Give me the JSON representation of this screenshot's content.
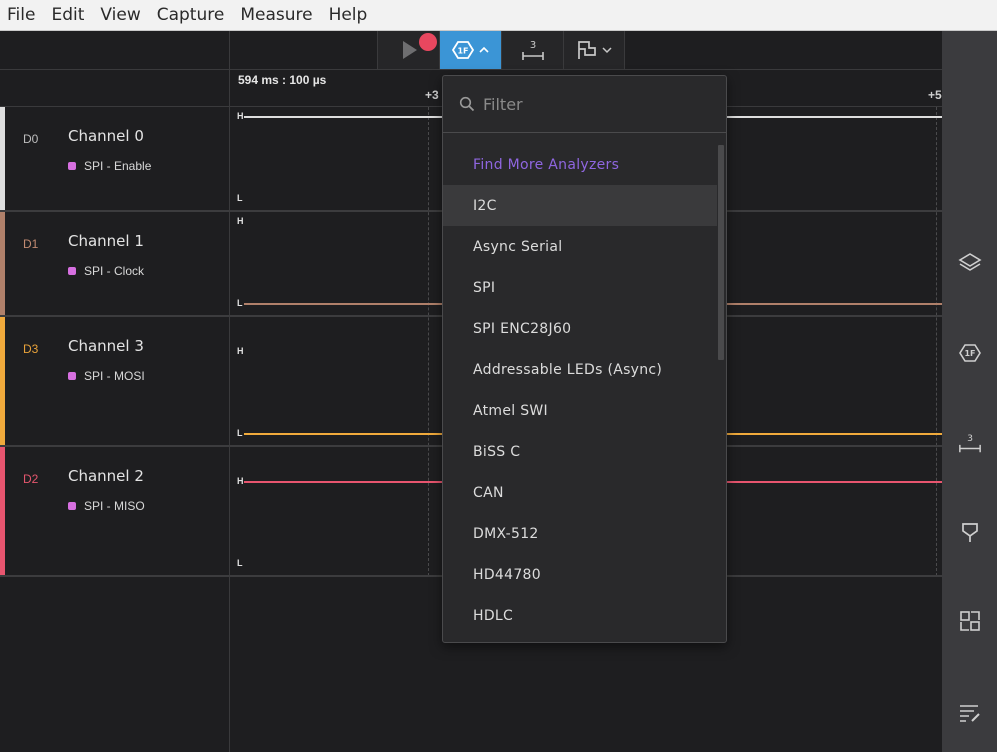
{
  "menubar": [
    "File",
    "Edit",
    "View",
    "Capture",
    "Measure",
    "Help"
  ],
  "timeline": {
    "cursor_time": "594 ms : 100 µs",
    "ticks": [
      "+3",
      "+5"
    ]
  },
  "channels": [
    {
      "id": "D0",
      "name": "Channel 0",
      "analyzer": "SPI - Enable",
      "color": "#dedede",
      "id_color": "#bdbdbd",
      "level_high": "H",
      "level_low": "L",
      "signal": "high"
    },
    {
      "id": "D1",
      "name": "Channel 1",
      "analyzer": "SPI - Clock",
      "color": "#b0806a",
      "id_color": "#c28b72",
      "level_high": "H",
      "level_low": "L",
      "signal": "low"
    },
    {
      "id": "D3",
      "name": "Channel 3",
      "analyzer": "SPI - MOSI",
      "color": "#f0aa3c",
      "id_color": "#e8a23a",
      "level_high": "H",
      "level_low": "L",
      "signal": "low"
    },
    {
      "id": "D2",
      "name": "Channel 2",
      "analyzer": "SPI - MISO",
      "color": "#e8556f",
      "id_color": "#e4566d",
      "level_high": "H",
      "level_low": "L",
      "signal": "high"
    }
  ],
  "toolbar": {
    "analyzer_count": "3"
  },
  "dropdown": {
    "filter_placeholder": "Filter",
    "items": [
      "Find More Analyzers",
      "I2C",
      "Async Serial",
      "SPI",
      "SPI ENC28J60",
      "Addressable LEDs (Async)",
      "Atmel SWI",
      "BiSS C",
      "CAN",
      "DMX-512",
      "HD44780",
      "HDLC"
    ]
  },
  "rail": {
    "timing_count": "3"
  },
  "colors": {
    "accent": "#3b95d6",
    "record": "#e8475f",
    "find_more": "#8f66e0",
    "analyzer_swatch": "#d66fe0"
  }
}
